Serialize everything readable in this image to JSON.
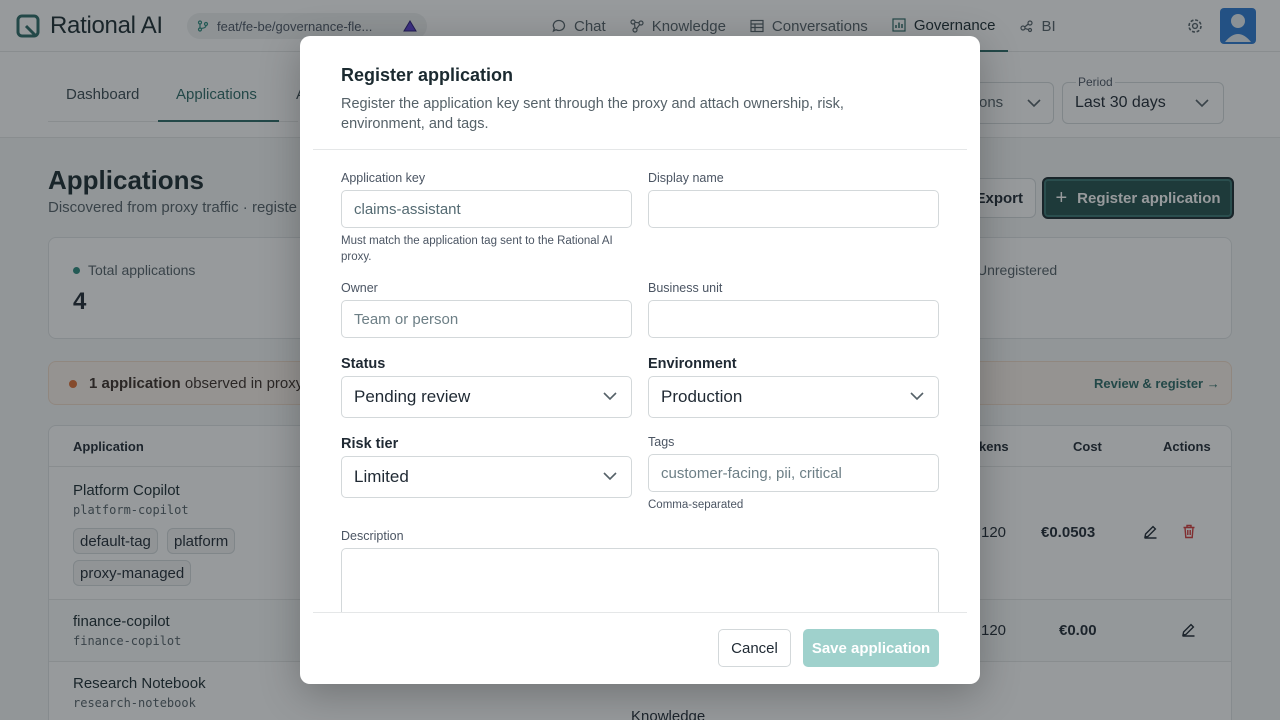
{
  "app": {
    "name": "Rational AI",
    "branch": "feat/fe-be/governance-fle..."
  },
  "nav": {
    "items": [
      {
        "label": "Chat",
        "icon": "chat-bubble-icon"
      },
      {
        "label": "Knowledge",
        "icon": "graph-nodes-icon"
      },
      {
        "label": "Conversations",
        "icon": "table-icon"
      },
      {
        "label": "Governance",
        "icon": "chart-icon"
      },
      {
        "label": "BI",
        "icon": "share-nodes-icon"
      }
    ],
    "active": "Governance"
  },
  "subnav": {
    "tabs": [
      "Dashboard",
      "Applications",
      "A"
    ],
    "active": "Applications"
  },
  "filters": {
    "first_partial": "ons",
    "period_label": "Period",
    "period_value": "Last 30 days"
  },
  "page": {
    "title": "Applications",
    "subtitle": "Discovered from proxy traffic · registe",
    "export_label": "Export",
    "register_label": "Register application"
  },
  "stats": {
    "total_label": "Total applications",
    "total_value": "4",
    "unregistered_label": "Unregistered"
  },
  "alert": {
    "count_text": "1 application",
    "rest_text": " observed in proxy",
    "link": "Review & register →"
  },
  "table": {
    "headers": {
      "application": "Application",
      "tokens": "kens",
      "cost": "Cost",
      "actions": "Actions"
    },
    "rows": [
      {
        "name": "Platform Copilot",
        "key": "platform-copilot",
        "tags": [
          "default-tag",
          "platform",
          "proxy-managed"
        ],
        "tokens": "120",
        "cost": "€0.0503"
      },
      {
        "name": "finance-copilot",
        "key": "finance-copilot",
        "tags": [],
        "tokens": "120",
        "cost": "€0.00"
      },
      {
        "name": "Research Notebook",
        "key": "research-notebook",
        "tags": [],
        "extra": "Knowledge"
      }
    ]
  },
  "modal": {
    "title": "Register application",
    "description": "Register the application key sent through the proxy and attach ownership, risk, environment, and tags.",
    "fields": {
      "app_key": {
        "label": "Application key",
        "value": "claims-assistant",
        "hint": "Must match the application tag sent to the Rational AI proxy."
      },
      "display_name": {
        "label": "Display name",
        "value": ""
      },
      "owner": {
        "label": "Owner",
        "placeholder": "Team or person"
      },
      "business_unit": {
        "label": "Business unit",
        "value": ""
      },
      "status": {
        "label": "Status",
        "value": "Pending review"
      },
      "environment": {
        "label": "Environment",
        "value": "Production"
      },
      "risk_tier": {
        "label": "Risk tier",
        "value": "Limited"
      },
      "tags": {
        "label": "Tags",
        "placeholder": "customer-facing, pii, critical",
        "hint": "Comma-separated"
      },
      "description": {
        "label": "Description",
        "value": ""
      }
    },
    "cancel_label": "Cancel",
    "save_label": "Save application"
  },
  "colors": {
    "brand": "#2d6a66",
    "primary_button": "#24504d",
    "save_disabled": "#9fd1cc",
    "alert_dot": "#de6d33",
    "delete": "#d63b3b"
  }
}
